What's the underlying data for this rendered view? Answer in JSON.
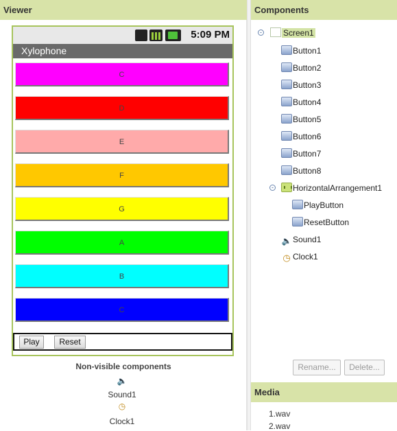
{
  "viewer": {
    "header": "Viewer",
    "phone": {
      "time": "5:09 PM",
      "title": "Xylophone",
      "notes": [
        {
          "label": "C",
          "color": "#ff00ff"
        },
        {
          "label": "D",
          "color": "#ff0000"
        },
        {
          "label": "E",
          "color": "#ffaaaa"
        },
        {
          "label": "F",
          "color": "#ffc800"
        },
        {
          "label": "G",
          "color": "#ffff00"
        },
        {
          "label": "A",
          "color": "#00ff00"
        },
        {
          "label": "B",
          "color": "#00ffff"
        },
        {
          "label": "C",
          "color": "#0000ff"
        }
      ],
      "play_label": "Play",
      "reset_label": "Reset"
    },
    "nonvisible": {
      "title": "Non-visible components",
      "items": [
        {
          "label": "Sound1",
          "icon": "speaker-icon"
        },
        {
          "label": "Clock1",
          "icon": "clock-icon"
        }
      ]
    }
  },
  "components": {
    "header": "Components",
    "tree": {
      "screen": "Screen1",
      "buttons": [
        "Button1",
        "Button2",
        "Button3",
        "Button4",
        "Button5",
        "Button6",
        "Button7",
        "Button8"
      ],
      "arrangement": "HorizontalArrangement1",
      "arrangement_children": [
        "PlayButton",
        "ResetButton"
      ],
      "sound": "Sound1",
      "clock": "Clock1"
    },
    "rename_label": "Rename...",
    "delete_label": "Delete..."
  },
  "media": {
    "header": "Media",
    "items": [
      "1.wav",
      "2.wav"
    ]
  },
  "colors": {
    "panel_header_bg": "#d8e3a8",
    "phone_border": "#a7c45c",
    "selected_bg": "#d3e3a5"
  }
}
